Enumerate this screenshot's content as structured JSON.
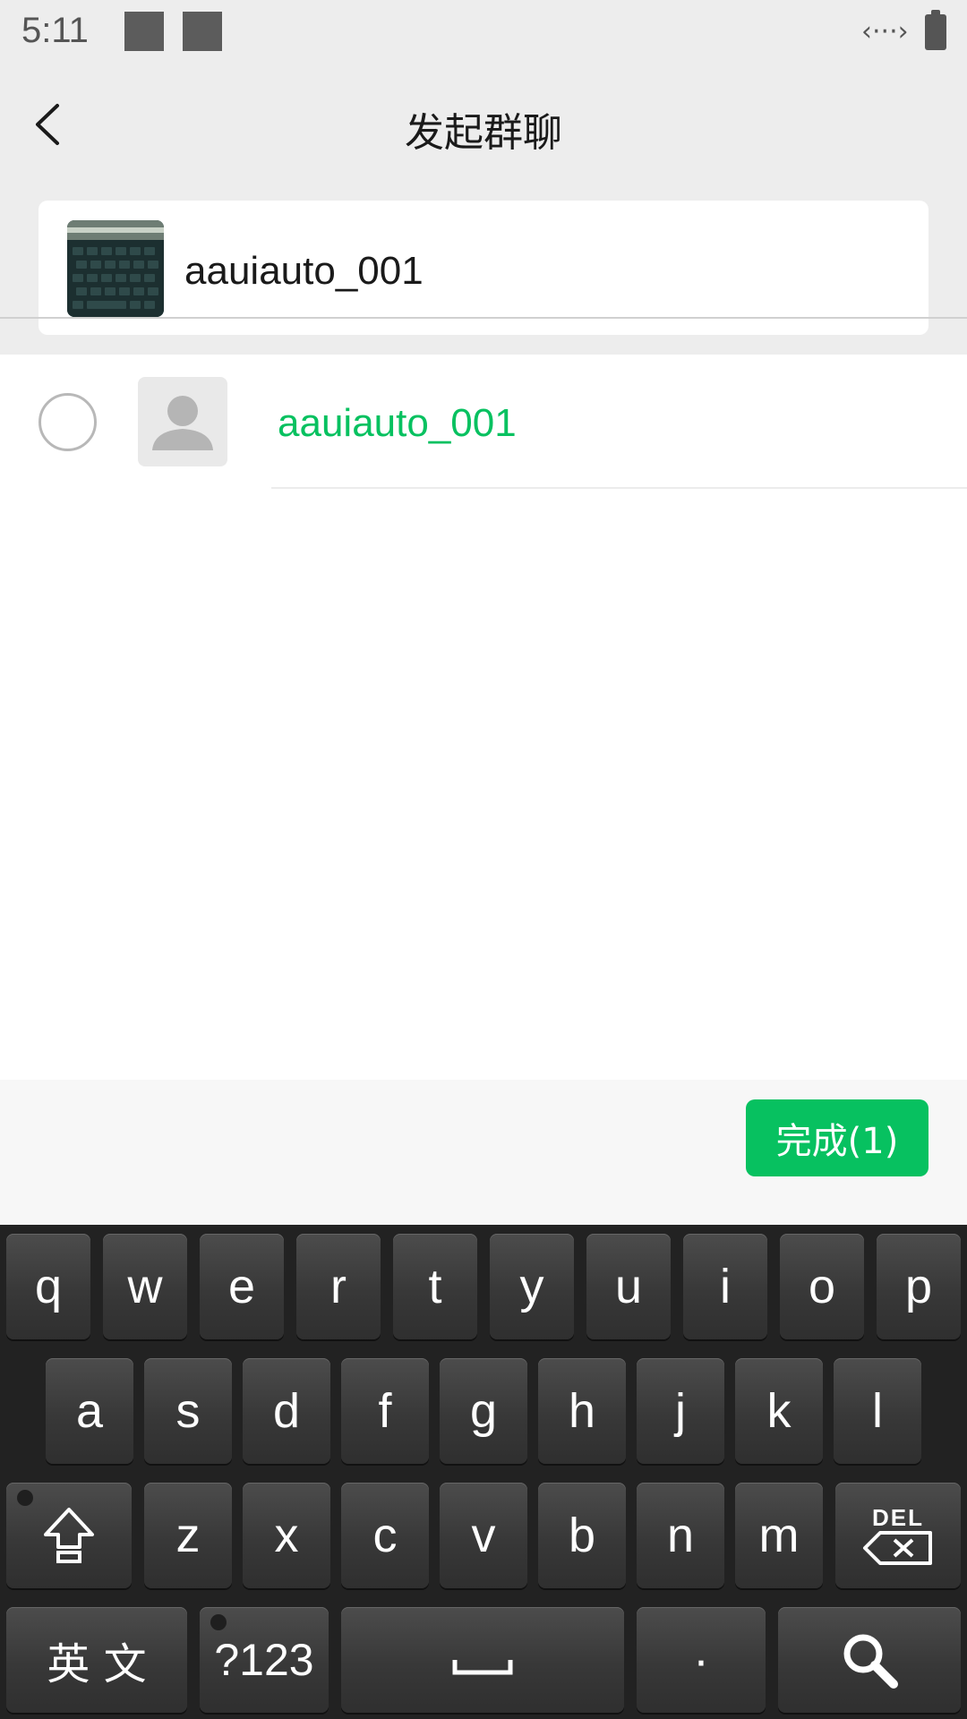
{
  "status_bar": {
    "time": "5:11",
    "network_glyph": "‹···›",
    "battery_icon": "battery-icon"
  },
  "header": {
    "title": "发起群聊",
    "back_icon": "back-chevron-icon"
  },
  "selected": {
    "name": "aauiauto_001"
  },
  "contacts": [
    {
      "name": "aauiauto_001",
      "checked": false
    }
  ],
  "bottom_bar": {
    "done_label": "完成(1)"
  },
  "keyboard": {
    "row1": [
      "q",
      "w",
      "e",
      "r",
      "t",
      "y",
      "u",
      "i",
      "o",
      "p"
    ],
    "row2": [
      "a",
      "s",
      "d",
      "f",
      "g",
      "h",
      "j",
      "k",
      "l"
    ],
    "row3": [
      "z",
      "x",
      "c",
      "v",
      "b",
      "n",
      "m"
    ],
    "lang_label": "英 文",
    "sym_label": "?123",
    "period_label": "·",
    "del_label": "DEL"
  },
  "colors": {
    "accent": "#07c160",
    "background": "#ededed",
    "keyboard_bg": "#222222"
  }
}
